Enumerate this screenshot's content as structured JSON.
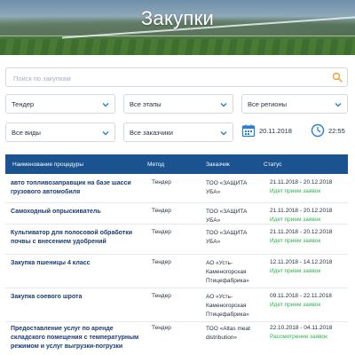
{
  "header": {
    "title": "Закупки"
  },
  "search": {
    "placeholder": "Поиск по закупкам"
  },
  "filters": {
    "type": "Тендер",
    "stages": "Все этапы",
    "regions": "Все регионы",
    "kinds": "Все виды",
    "customers": "Все заказчики",
    "date": "20.11.2018",
    "time": "22:55"
  },
  "table": {
    "columns": {
      "name": "Наименование процедуры",
      "method": "Метод",
      "customer": "Заказчик",
      "status": "Статус"
    },
    "rows": [
      {
        "name": "авто топливозаправщик на базе шасси грузового автомобиля",
        "method": "Тендер",
        "customer": "ТОО «ЗАЩИТА УБА»",
        "dates": "21.11.2018 - 20.12.2018",
        "status": "Идет прием заявок"
      },
      {
        "name": "Самоходный опрыскиватель",
        "method": "Тендер",
        "customer": "ТОО «ЗАЩИТА УБА»",
        "dates": "21.11.2018 - 20.12.2018",
        "status": "Идет прием заявок"
      },
      {
        "name": "Культиватор для полосовой обработки почвы с внесением удобрений",
        "method": "Тендер",
        "customer": "ТОО «ЗАЩИТА УБА»",
        "dates": "21.11.2018 - 20.12.2018",
        "status": "Идет прием заявок"
      },
      {
        "name": "Закупка пшеницы 4 класс",
        "method": "Тендер",
        "customer": "АО «Усть-Каменогорская Птицефабрика»",
        "dates": "12.11.2018 - 14.12.2018",
        "status": "Идет прием заявок"
      },
      {
        "name": "Закупка соевого шрота",
        "method": "Тендер",
        "customer": "АО «Усть-Каменогорская Птицефабрика»",
        "dates": "09.11.2018 - 22.11.2018",
        "status": "Идет прием заявок"
      },
      {
        "name": "Предоставление услуг по аренде складского помещения с температурным режимом и услуг выгрузки-погрузки",
        "method": "Тендер",
        "customer": "ТОО «Altas meat distribution»",
        "dates": "22.10.2018 - 04.11.2018",
        "status": "Рассмотрение заявок"
      }
    ]
  },
  "colors": {
    "header_bg": "#1a5390",
    "accent": "#2a7fd4",
    "status_green": "#2bb34a",
    "link": "#1a3c6e"
  }
}
